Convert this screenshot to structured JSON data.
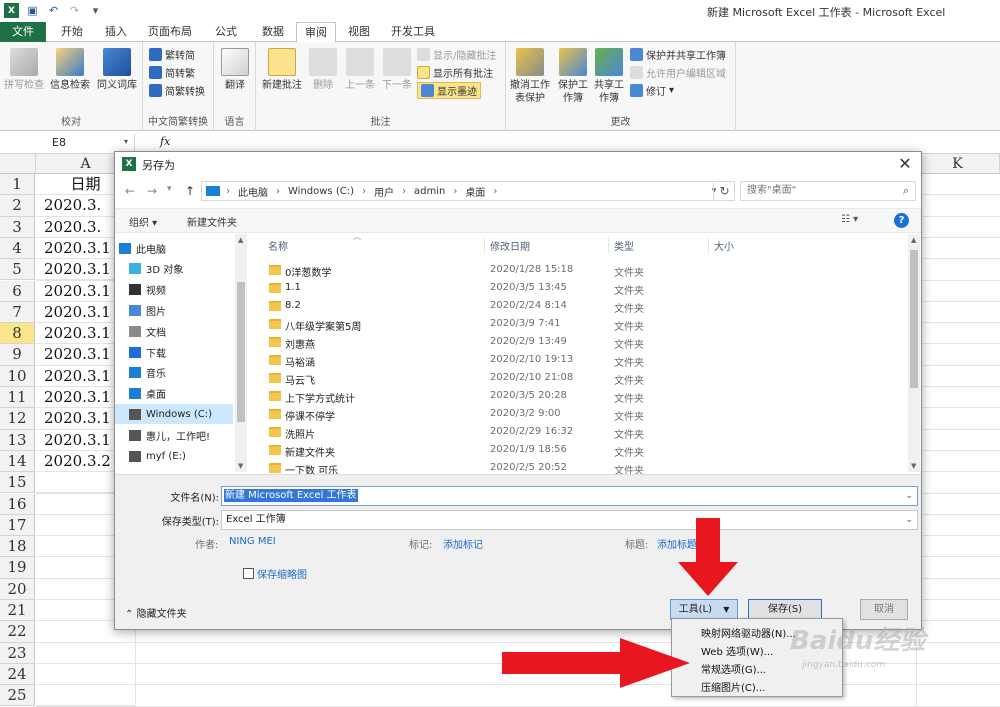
{
  "window": {
    "title": "新建 Microsoft Excel 工作表 - Microsoft Excel"
  },
  "tabs": [
    {
      "label": "文件"
    },
    {
      "label": "开始"
    },
    {
      "label": "插入"
    },
    {
      "label": "页面布局"
    },
    {
      "label": "公式"
    },
    {
      "label": "数据"
    },
    {
      "label": "审阅"
    },
    {
      "label": "视图"
    },
    {
      "label": "开发工具"
    }
  ],
  "ribbon": {
    "proofing": {
      "label": "校对",
      "spell": "拼写检查",
      "research": "信息检索",
      "thesaurus": "同义词库"
    },
    "chinese": {
      "label": "中文简繁转换",
      "to_trad": "繁转简",
      "to_simp": "简转繁",
      "convert": "简繁转换"
    },
    "language": {
      "label": "语言",
      "translate": "翻译"
    },
    "comments": {
      "label": "批注",
      "new": "新建批注",
      "delete": "删除",
      "prev": "上一条",
      "next": "下一条",
      "show_hide": "显示/隐藏批注",
      "show_all": "显示所有批注",
      "show_ink": "显示墨迹"
    },
    "changes": {
      "label": "更改",
      "unprotect_sheet": "撤消工作表保护",
      "protect_wb": "保护工作簿",
      "share_wb": "共享工作簿",
      "protect_share": "保护并共享工作簿",
      "allow_edit": "允许用户编辑区域",
      "track": "修订"
    }
  },
  "formula_bar": {
    "name_box": "E8",
    "fx": "fx"
  },
  "sheet": {
    "col_a": "A",
    "col_k": "K",
    "rows": [
      "1",
      "2",
      "3",
      "4",
      "5",
      "6",
      "7",
      "8",
      "9",
      "10",
      "11",
      "12",
      "13",
      "14",
      "15",
      "16",
      "17",
      "18",
      "19",
      "20",
      "21",
      "22",
      "23",
      "24",
      "25"
    ],
    "selected_row": "8",
    "a_values": [
      "日期",
      "2020.3.",
      "2020.3.",
      "2020.3.1",
      "2020.3.1",
      "2020.3.1",
      "2020.3.1",
      "2020.3.1",
      "2020.3.1",
      "2020.3.1",
      "2020.3.1",
      "2020.3.1",
      "2020.3.1",
      "2020.3.2"
    ]
  },
  "dialog": {
    "title": "另存为",
    "breadcrumb": [
      "此电脑",
      "Windows (C:)",
      "用户",
      "admin",
      "桌面"
    ],
    "search_placeholder": "搜索\"桌面\"",
    "organize": "组织 ▾",
    "new_folder": "新建文件夹",
    "nav": [
      {
        "label": "此电脑"
      },
      {
        "label": "3D 对象"
      },
      {
        "label": "视频"
      },
      {
        "label": "图片"
      },
      {
        "label": "文档"
      },
      {
        "label": "下载"
      },
      {
        "label": "音乐"
      },
      {
        "label": "桌面"
      },
      {
        "label": "Windows (C:)"
      },
      {
        "label": "惠儿，工作吧!"
      },
      {
        "label": "myf (E:)"
      }
    ],
    "columns": {
      "name": "名称",
      "date": "修改日期",
      "type": "类型",
      "size": "大小"
    },
    "files": [
      {
        "name": "0洋葱数学",
        "date": "2020/1/28 15:18",
        "type": "文件夹"
      },
      {
        "name": "1.1",
        "date": "2020/3/5 13:45",
        "type": "文件夹"
      },
      {
        "name": "8.2",
        "date": "2020/2/24 8:14",
        "type": "文件夹"
      },
      {
        "name": "八年级学案第5周",
        "date": "2020/3/9 7:41",
        "type": "文件夹"
      },
      {
        "name": "刘惠燕",
        "date": "2020/2/9 13:49",
        "type": "文件夹"
      },
      {
        "name": "马裕涵",
        "date": "2020/2/10 19:13",
        "type": "文件夹"
      },
      {
        "name": "马云飞",
        "date": "2020/2/10 21:08",
        "type": "文件夹"
      },
      {
        "name": "上下学方式统计",
        "date": "2020/3/5 20:28",
        "type": "文件夹"
      },
      {
        "name": "停课不停学",
        "date": "2020/3/2 9:00",
        "type": "文件夹"
      },
      {
        "name": "洗照片",
        "date": "2020/2/29 16:32",
        "type": "文件夹"
      },
      {
        "name": "新建文件夹",
        "date": "2020/1/9 18:56",
        "type": "文件夹"
      },
      {
        "name": "一下数 可乐",
        "date": "2020/2/5 20:52",
        "type": "文件夹"
      }
    ],
    "filename_label": "文件名(N):",
    "filename": "新建 Microsoft Excel 工作表",
    "filetype_label": "保存类型(T):",
    "filetype": "Excel 工作簿",
    "author_label": "作者:",
    "author": "NING MEI",
    "tags_label": "标记:",
    "tags": "添加标记",
    "title_label": "标题:",
    "title_val": "添加标题",
    "save_thumbnail": "保存缩略图",
    "hide_folders": "隐藏文件夹",
    "tools": "工具(L)",
    "save": "保存(S)",
    "cancel": "取消"
  },
  "tools_menu": [
    "映射网络驱动器(N)...",
    "Web 选项(W)...",
    "常规选项(G)...",
    "压缩图片(C)..."
  ],
  "watermark": {
    "logo": "Baidu经验",
    "url": "jingyan.baidu.com"
  },
  "colors": {
    "excel_green": "#1e7145",
    "arrow_red": "#e8161e",
    "selection_blue": "#3377d6"
  }
}
